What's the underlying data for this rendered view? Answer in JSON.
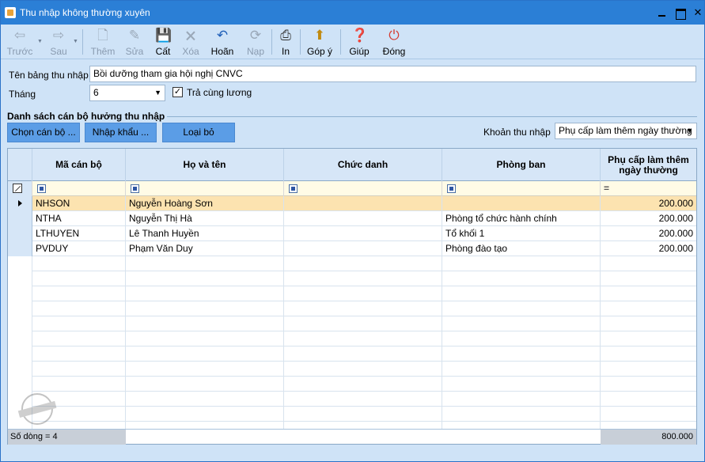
{
  "window": {
    "title": "Thu nhập không thường xuyên"
  },
  "toolbar": {
    "buttons": [
      {
        "label": "Trước",
        "icon": "arrow-left-icon",
        "enabled": false
      },
      {
        "label": "Sau",
        "icon": "arrow-right-icon",
        "enabled": false
      },
      {
        "label": "Thêm",
        "icon": "new-document-icon",
        "enabled": false
      },
      {
        "label": "Sửa",
        "icon": "edit-document-icon",
        "enabled": false
      },
      {
        "label": "Cất",
        "icon": "save-icon",
        "enabled": true
      },
      {
        "label": "Xóa",
        "icon": "delete-document-icon",
        "enabled": false
      },
      {
        "label": "Hoãn",
        "icon": "undo-icon",
        "enabled": true
      },
      {
        "label": "Nạp",
        "icon": "refresh-icon",
        "enabled": false
      },
      {
        "label": "In",
        "icon": "print-icon",
        "enabled": true
      },
      {
        "label": "Góp ý",
        "icon": "feedback-icon",
        "enabled": true
      },
      {
        "label": "Giúp",
        "icon": "help-icon",
        "enabled": true
      },
      {
        "label": "Đóng",
        "icon": "power-icon",
        "enabled": true
      }
    ]
  },
  "form": {
    "name_label": "Tên bảng thu nhập",
    "name_value": "Bồi dưỡng tham gia hội nghị CNVC",
    "month_label": "Tháng",
    "month_value": "6",
    "pay_with_salary_label": "Trả cùng lương",
    "pay_with_salary_checked": true
  },
  "group": {
    "title": "Danh sách cán bộ hưởng thu nhập",
    "choose_button": "Chọn cán bộ ...",
    "import_button": "Nhập khẩu ...",
    "remove_button": "Loại bỏ",
    "income_type_label": "Khoản thu nhập",
    "income_type_value": "Phụ cấp làm thêm ngày thường"
  },
  "grid": {
    "columns": [
      "Mã cán bộ",
      "Họ và tên",
      "Chức danh",
      "Phòng ban",
      "Phụ cấp làm thêm ngày thường"
    ],
    "rows": [
      {
        "code": "NHSON",
        "name": "Nguyễn Hoàng Sơn",
        "title": "",
        "department": "",
        "amount": "200.000"
      },
      {
        "code": "NTHA",
        "name": "Nguyễn Thị Hà",
        "title": "",
        "department": "Phòng tổ chức hành chính",
        "amount": "200.000"
      },
      {
        "code": "LTHUYEN",
        "name": "Lê Thanh Huyền",
        "title": "",
        "department": "Tổ khối 1",
        "amount": "200.000"
      },
      {
        "code": "PVDUY",
        "name": "Phạm Văn Duy",
        "title": "",
        "department": "Phòng đào tạo",
        "amount": "200.000"
      }
    ],
    "footer_count": "Số dòng = 4",
    "footer_total": "800.000"
  },
  "colors": {
    "title_bar": "#2b7fd6",
    "selected_row": "#fce3b0",
    "action_button": "#5b9de6"
  }
}
